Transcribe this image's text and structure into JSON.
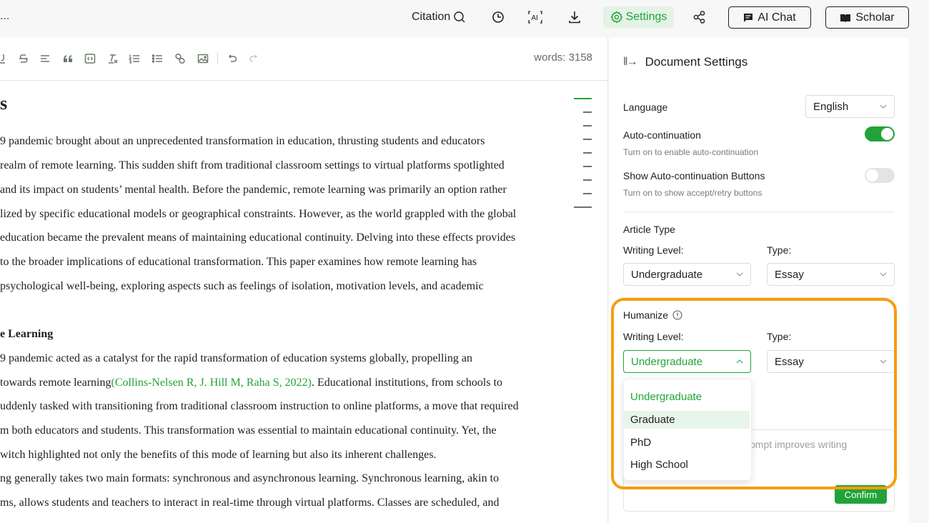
{
  "topbar": {
    "doc_title_fragment": "...",
    "citation_label": "Citation",
    "settings_label": "Settings",
    "ai_chat_label": "AI Chat",
    "scholar_label": "Scholar"
  },
  "editor": {
    "word_count": "words: 3158",
    "heading_fragment": "s",
    "paragraph1": [
      "9 pandemic brought about an unprecedented transformation in education, thrusting students and educators",
      "realm of remote learning. This sudden shift from traditional classroom settings to virtual platforms spotlighted",
      "and its impact on students’ mental health. Before the pandemic, remote learning was primarily an option rather",
      "lized by specific educational models or geographical constraints. However, as the world grappled with the global",
      " education became the prevalent means of maintaining educational continuity. Delving into these effects provides",
      "to the broader implications of educational transformation. This paper examines how remote learning has",
      "psychological well-being, exploring aspects such as feelings of isolation, motivation levels, and academic"
    ],
    "section_title": "e Learning",
    "paragraph2_line1": "9 pandemic acted as a catalyst for the rapid transformation of education systems globally, propelling an",
    "paragraph2_line2_pre": " towards remote learning",
    "citation": "(Collins-Nelsen R, J. Hill M, Raha S, 2022)",
    "paragraph2_line2_post": ". Educational institutions, from schools to",
    "paragraph2_rest": [
      "uddenly tasked with transitioning from traditional classroom instruction to online platforms, a move that required",
      "m both educators and students. This transformation was essential to maintain educational continuity. Yet, the",
      "witch highlighted not only the benefits of this mode of learning but also its inherent challenges.",
      "ng generally takes two main formats: synchronous and asynchronous learning. Synchronous learning, akin to",
      "ms, allows students and teachers to interact in real-time through virtual platforms. Classes are scheduled, and"
    ]
  },
  "toolbar_icons": [
    "underline-icon",
    "strikethrough-icon",
    "align-icon",
    "quote-icon",
    "code-block-icon",
    "clear-format-icon",
    "ordered-list-icon",
    "bullet-list-icon",
    "link-icon",
    "image-icon",
    "undo-icon",
    "redo-icon"
  ],
  "settings": {
    "title": "Document Settings",
    "language_label": "Language",
    "language_value": "English",
    "autocontinuation_label": "Auto-continuation",
    "autocontinuation_sub": "Turn on to enable auto-continuation",
    "autocontinuation_on": true,
    "show_buttons_label": "Show Auto-continuation Buttons",
    "show_buttons_sub": "Turn on to show accept/retry buttons",
    "show_buttons_on": false,
    "article_type_label": "Article Type",
    "writing_level_label": "Writing Level:",
    "type_label": "Type:",
    "article_writing_level": "Undergraduate",
    "article_type": "Essay",
    "humanize_label": "Humanize",
    "humanize_writing_level": "Undergraduate",
    "humanize_type": "Essay",
    "prompt_placeholder_fragment": "ompt improves writing",
    "confirm_label": "Confirm",
    "writing_level_options": [
      "Undergraduate",
      "Graduate",
      "PhD",
      "High School"
    ]
  },
  "colors": {
    "accent": "#22a33a",
    "highlight": "#f59e0b"
  }
}
